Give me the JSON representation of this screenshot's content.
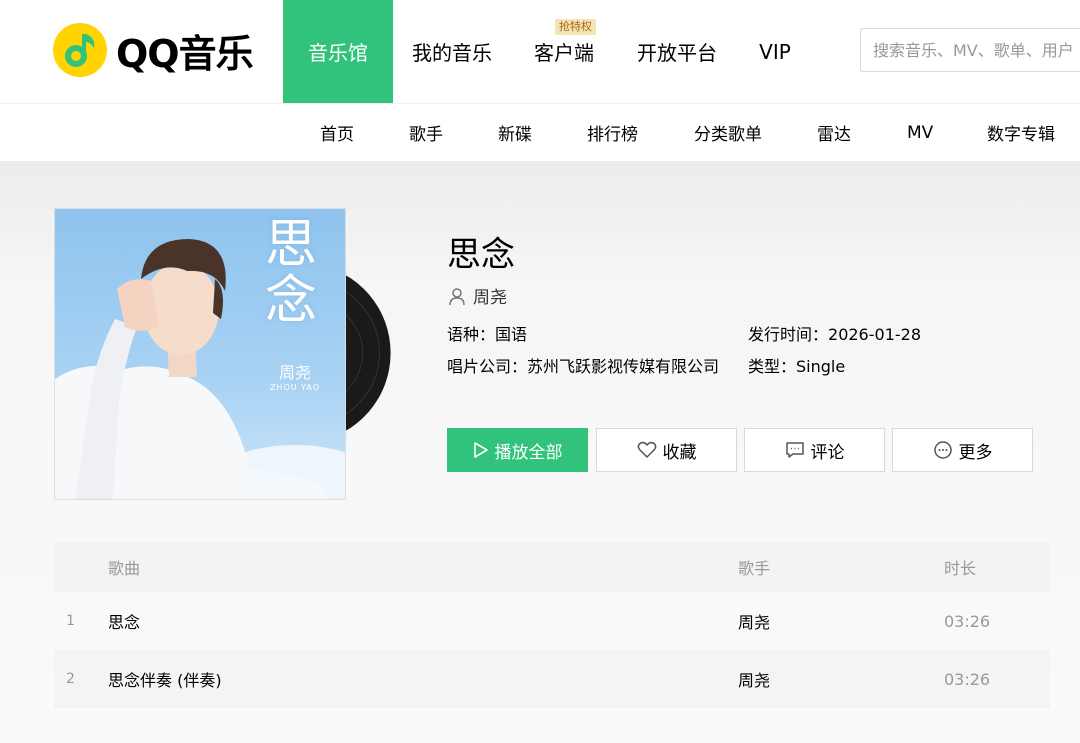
{
  "brand": {
    "name": "QQ音乐",
    "accent": "#31c27c",
    "logo_color": "#ffd400"
  },
  "main_nav": [
    {
      "label": "音乐馆",
      "active": true
    },
    {
      "label": "我的音乐"
    },
    {
      "label": "客户端",
      "badge": "抢特权"
    },
    {
      "label": "开放平台"
    },
    {
      "label": "VIP"
    }
  ],
  "search": {
    "placeholder": "搜索音乐、MV、歌单、用户"
  },
  "sub_nav": [
    "首页",
    "歌手",
    "新碟",
    "排行榜",
    "分类歌单",
    "雷达",
    "MV",
    "数字专辑"
  ],
  "album": {
    "cover_title": "思念",
    "cover_artist": "周尧",
    "cover_pinyin": "ZHOU YAO",
    "title": "思念",
    "singer": "周尧",
    "language_label": "语种：",
    "language": "国语",
    "release_label": "发行时间：",
    "release_date": "2026-01-28",
    "label_label": "唱片公司：",
    "label": "苏州飞跃影视传媒有限公司",
    "type_label": "类型：",
    "type": "Single"
  },
  "actions": {
    "play_all": "播放全部",
    "favorite": "收藏",
    "comment": "评论",
    "more": "更多"
  },
  "table": {
    "headers": {
      "song": "歌曲",
      "singer": "歌手",
      "duration": "时长"
    },
    "rows": [
      {
        "index": "1",
        "song": "思念",
        "singer": "周尧",
        "duration": "03:26"
      },
      {
        "index": "2",
        "song": "思念伴奏 (伴奏)",
        "singer": "周尧",
        "duration": "03:26"
      }
    ]
  }
}
